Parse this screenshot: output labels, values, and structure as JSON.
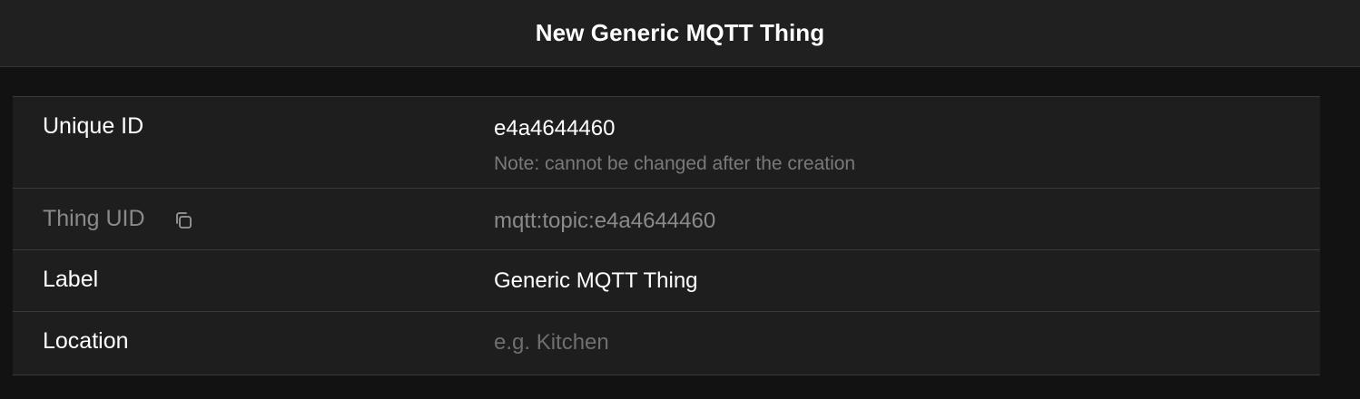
{
  "navbar": {
    "title": "New Generic MQTT Thing"
  },
  "form": {
    "unique_id": {
      "label": "Unique ID",
      "value": "e4a4644460",
      "note": "Note: cannot be changed after the creation"
    },
    "thing_uid": {
      "label": "Thing UID",
      "value": "mqtt:topic:e4a4644460",
      "icon": "copy-icon"
    },
    "label": {
      "label": "Label",
      "value": "Generic MQTT Thing"
    },
    "location": {
      "label": "Location",
      "value": "",
      "placeholder": "e.g. Kitchen"
    }
  }
}
